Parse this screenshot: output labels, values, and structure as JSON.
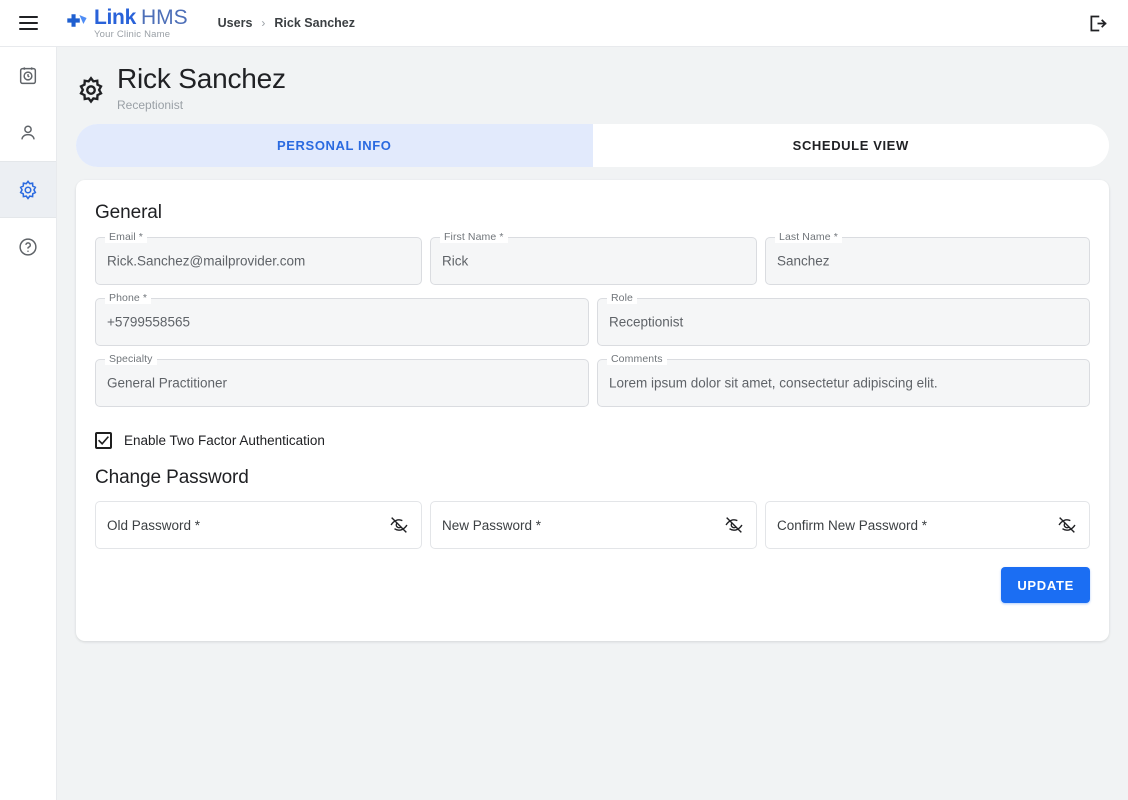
{
  "app": {
    "logo_primary": "Link",
    "logo_secondary": "HMS",
    "logo_tagline": "Your Clinic Name",
    "accent_color": "#1b6ef3",
    "logo_color": "#2962d9"
  },
  "topbar": {
    "menu_icon": "hamburger-menu-icon",
    "logout_icon": "logout-icon",
    "breadcrumb": [
      {
        "label": "Users"
      },
      {
        "label": "Rick Sanchez"
      }
    ],
    "breadcrumb_separator": "›"
  },
  "sidebar": {
    "items": [
      {
        "name": "appointments",
        "icon": "calendar-clock-icon",
        "active": false
      },
      {
        "name": "users",
        "icon": "person-icon",
        "active": false
      },
      {
        "name": "settings",
        "icon": "gear-icon",
        "active": true
      },
      {
        "name": "help",
        "icon": "help-circle-icon",
        "active": false
      }
    ]
  },
  "page": {
    "icon": "gear-icon",
    "title": "Rick Sanchez",
    "subtitle": "Receptionist"
  },
  "tabs": [
    {
      "label": "PERSONAL INFO",
      "active": true
    },
    {
      "label": "SCHEDULE VIEW",
      "active": false
    }
  ],
  "general": {
    "heading": "General",
    "fields": {
      "email": {
        "label": "Email *",
        "value": "Rick.Sanchez@mailprovider.com"
      },
      "first_name": {
        "label": "First Name *",
        "value": "Rick"
      },
      "last_name": {
        "label": "Last Name *",
        "value": "Sanchez"
      },
      "phone": {
        "label": "Phone *",
        "value": "+5799558565"
      },
      "role": {
        "label": "Role",
        "value": "Receptionist"
      },
      "specialty": {
        "label": "Specialty",
        "value": "General Practitioner"
      },
      "comments": {
        "label": "Comments",
        "value": "Lorem ipsum dolor sit amet, consectetur adipiscing elit."
      }
    }
  },
  "two_factor": {
    "label": "Enable Two Factor Authentication",
    "checked": true
  },
  "change_password": {
    "heading": "Change Password",
    "fields": {
      "old_password": {
        "placeholder": "Old Password *",
        "visibility_icon": "eye-off-icon"
      },
      "new_password": {
        "placeholder": "New Password *",
        "visibility_icon": "eye-off-icon"
      },
      "confirm_password": {
        "placeholder": "Confirm New Password *",
        "visibility_icon": "eye-off-icon"
      }
    }
  },
  "actions": {
    "update_label": "UPDATE"
  }
}
